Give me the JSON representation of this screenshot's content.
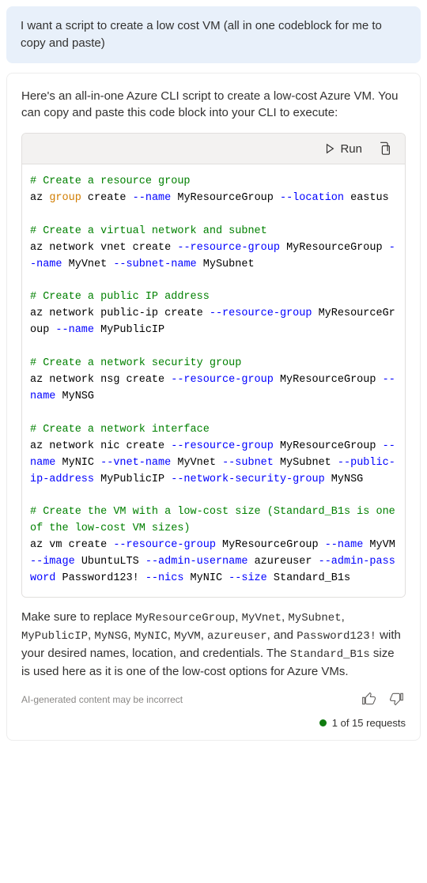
{
  "user_message": "I want a script to create a low cost VM (all in one codeblock for me to copy and paste)",
  "assistant_intro": "Here's an all-in-one Azure CLI script to create a low-cost Azure VM. You can copy and paste this code block into your CLI to execute:",
  "code_header": {
    "run_label": "Run"
  },
  "code_lines": [
    {
      "tokens": [
        {
          "text": "# Create a resource group",
          "class": "tok-comment"
        }
      ]
    },
    {
      "tokens": [
        {
          "text": "az ",
          "class": "tok-plain"
        },
        {
          "text": "group",
          "class": "tok-keyword"
        },
        {
          "text": " create ",
          "class": "tok-plain"
        },
        {
          "text": "--name",
          "class": "tok-flag"
        },
        {
          "text": " MyResourceGroup ",
          "class": "tok-plain"
        },
        {
          "text": "--location",
          "class": "tok-flag"
        },
        {
          "text": " eastus",
          "class": "tok-plain"
        }
      ]
    },
    {
      "tokens": [
        {
          "text": "",
          "class": "tok-plain"
        }
      ]
    },
    {
      "tokens": [
        {
          "text": "# Create a virtual network and subnet",
          "class": "tok-comment"
        }
      ]
    },
    {
      "tokens": [
        {
          "text": "az network vnet create ",
          "class": "tok-plain"
        },
        {
          "text": "--resource-group",
          "class": "tok-flag"
        },
        {
          "text": " MyResourceGroup ",
          "class": "tok-plain"
        },
        {
          "text": "--name",
          "class": "tok-flag"
        },
        {
          "text": " MyVnet ",
          "class": "tok-plain"
        },
        {
          "text": "--subnet-name",
          "class": "tok-flag"
        },
        {
          "text": " MySubnet",
          "class": "tok-plain"
        }
      ]
    },
    {
      "tokens": [
        {
          "text": "",
          "class": "tok-plain"
        }
      ]
    },
    {
      "tokens": [
        {
          "text": "# Create a public IP address",
          "class": "tok-comment"
        }
      ]
    },
    {
      "tokens": [
        {
          "text": "az network public-ip create ",
          "class": "tok-plain"
        },
        {
          "text": "--resource-group",
          "class": "tok-flag"
        },
        {
          "text": " MyResourceGroup ",
          "class": "tok-plain"
        },
        {
          "text": "--name",
          "class": "tok-flag"
        },
        {
          "text": " MyPublicIP",
          "class": "tok-plain"
        }
      ]
    },
    {
      "tokens": [
        {
          "text": "",
          "class": "tok-plain"
        }
      ]
    },
    {
      "tokens": [
        {
          "text": "# Create a network security group",
          "class": "tok-comment"
        }
      ]
    },
    {
      "tokens": [
        {
          "text": "az network nsg create ",
          "class": "tok-plain"
        },
        {
          "text": "--resource-group",
          "class": "tok-flag"
        },
        {
          "text": " MyResourceGroup ",
          "class": "tok-plain"
        },
        {
          "text": "--name",
          "class": "tok-flag"
        },
        {
          "text": " MyNSG",
          "class": "tok-plain"
        }
      ]
    },
    {
      "tokens": [
        {
          "text": "",
          "class": "tok-plain"
        }
      ]
    },
    {
      "tokens": [
        {
          "text": "# Create a network interface",
          "class": "tok-comment"
        }
      ]
    },
    {
      "tokens": [
        {
          "text": "az network nic create ",
          "class": "tok-plain"
        },
        {
          "text": "--resource-group",
          "class": "tok-flag"
        },
        {
          "text": " MyResourceGroup ",
          "class": "tok-plain"
        },
        {
          "text": "--name",
          "class": "tok-flag"
        },
        {
          "text": " MyNIC ",
          "class": "tok-plain"
        },
        {
          "text": "--vnet-name",
          "class": "tok-flag"
        },
        {
          "text": " MyVnet ",
          "class": "tok-plain"
        },
        {
          "text": "--subnet",
          "class": "tok-flag"
        },
        {
          "text": " MySubnet ",
          "class": "tok-plain"
        },
        {
          "text": "--public-ip-address",
          "class": "tok-flag"
        },
        {
          "text": " MyPublicIP ",
          "class": "tok-plain"
        },
        {
          "text": "--network-security-group",
          "class": "tok-flag"
        },
        {
          "text": " MyNSG",
          "class": "tok-plain"
        }
      ]
    },
    {
      "tokens": [
        {
          "text": "",
          "class": "tok-plain"
        }
      ]
    },
    {
      "tokens": [
        {
          "text": "# Create the VM with a low-cost size (Standard_B1s is one of the low-cost VM sizes)",
          "class": "tok-comment"
        }
      ]
    },
    {
      "tokens": [
        {
          "text": "az vm create ",
          "class": "tok-plain"
        },
        {
          "text": "--resource-group",
          "class": "tok-flag"
        },
        {
          "text": " MyResourceGroup ",
          "class": "tok-plain"
        },
        {
          "text": "--name",
          "class": "tok-flag"
        },
        {
          "text": " MyVM ",
          "class": "tok-plain"
        },
        {
          "text": "--image",
          "class": "tok-flag"
        },
        {
          "text": " UbuntuLTS ",
          "class": "tok-plain"
        },
        {
          "text": "--admin-username",
          "class": "tok-flag"
        },
        {
          "text": " azureuser ",
          "class": "tok-plain"
        },
        {
          "text": "--admin-password",
          "class": "tok-flag"
        },
        {
          "text": " Password123! ",
          "class": "tok-plain"
        },
        {
          "text": "--nics",
          "class": "tok-flag"
        },
        {
          "text": " MyNIC ",
          "class": "tok-plain"
        },
        {
          "text": "--size",
          "class": "tok-flag"
        },
        {
          "text": " Standard_B1s",
          "class": "tok-plain"
        }
      ]
    }
  ],
  "outro": {
    "pre1": "Make sure to replace ",
    "tokens": [
      "MyResourceGroup",
      "MyVnet",
      "MySubnet",
      "MyPublicIP",
      "MyNSG",
      "MyNIC",
      "MyVM",
      "azureuser",
      "Password123!"
    ],
    "sep1": ", ",
    "and": ", and ",
    "mid": " with your desired names, location, and credentials. The ",
    "size_token": "Standard_B1s",
    "post": " size is used here as it is one of the low-cost options for Azure VMs."
  },
  "disclaimer": "AI-generated content may be incorrect",
  "status": "1 of 15 requests"
}
